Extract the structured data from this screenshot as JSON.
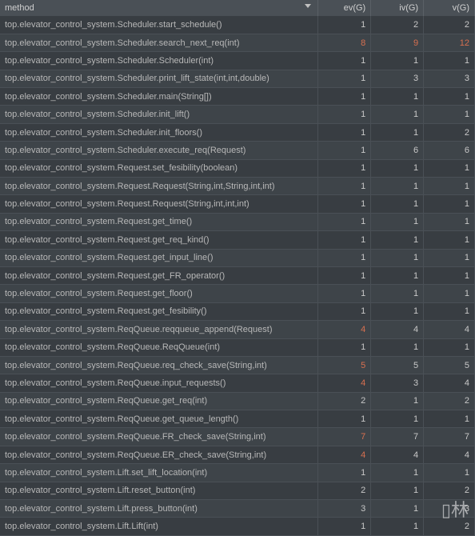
{
  "header": {
    "method": "method",
    "ev": "ev(G)",
    "iv": "iv(G)",
    "v": "v(G)"
  },
  "rows": [
    {
      "method": "top.elevator_control_system.Scheduler.start_schedule()",
      "ev": "1",
      "iv": "2",
      "v": "2",
      "h_ev": false,
      "h_iv": false,
      "h_v": false
    },
    {
      "method": "top.elevator_control_system.Scheduler.search_next_req(int)",
      "ev": "8",
      "iv": "9",
      "v": "12",
      "h_ev": true,
      "h_iv": true,
      "h_v": true
    },
    {
      "method": "top.elevator_control_system.Scheduler.Scheduler(int)",
      "ev": "1",
      "iv": "1",
      "v": "1",
      "h_ev": false,
      "h_iv": false,
      "h_v": false
    },
    {
      "method": "top.elevator_control_system.Scheduler.print_lift_state(int,int,double)",
      "ev": "1",
      "iv": "3",
      "v": "3",
      "h_ev": false,
      "h_iv": false,
      "h_v": false
    },
    {
      "method": "top.elevator_control_system.Scheduler.main(String[])",
      "ev": "1",
      "iv": "1",
      "v": "1",
      "h_ev": false,
      "h_iv": false,
      "h_v": false
    },
    {
      "method": "top.elevator_control_system.Scheduler.init_lift()",
      "ev": "1",
      "iv": "1",
      "v": "1",
      "h_ev": false,
      "h_iv": false,
      "h_v": false
    },
    {
      "method": "top.elevator_control_system.Scheduler.init_floors()",
      "ev": "1",
      "iv": "1",
      "v": "2",
      "h_ev": false,
      "h_iv": false,
      "h_v": false
    },
    {
      "method": "top.elevator_control_system.Scheduler.execute_req(Request)",
      "ev": "1",
      "iv": "6",
      "v": "6",
      "h_ev": false,
      "h_iv": false,
      "h_v": false
    },
    {
      "method": "top.elevator_control_system.Request.set_fesibility(boolean)",
      "ev": "1",
      "iv": "1",
      "v": "1",
      "h_ev": false,
      "h_iv": false,
      "h_v": false
    },
    {
      "method": "top.elevator_control_system.Request.Request(String,int,String,int,int)",
      "ev": "1",
      "iv": "1",
      "v": "1",
      "h_ev": false,
      "h_iv": false,
      "h_v": false
    },
    {
      "method": "top.elevator_control_system.Request.Request(String,int,int,int)",
      "ev": "1",
      "iv": "1",
      "v": "1",
      "h_ev": false,
      "h_iv": false,
      "h_v": false
    },
    {
      "method": "top.elevator_control_system.Request.get_time()",
      "ev": "1",
      "iv": "1",
      "v": "1",
      "h_ev": false,
      "h_iv": false,
      "h_v": false
    },
    {
      "method": "top.elevator_control_system.Request.get_req_kind()",
      "ev": "1",
      "iv": "1",
      "v": "1",
      "h_ev": false,
      "h_iv": false,
      "h_v": false
    },
    {
      "method": "top.elevator_control_system.Request.get_input_line()",
      "ev": "1",
      "iv": "1",
      "v": "1",
      "h_ev": false,
      "h_iv": false,
      "h_v": false
    },
    {
      "method": "top.elevator_control_system.Request.get_FR_operator()",
      "ev": "1",
      "iv": "1",
      "v": "1",
      "h_ev": false,
      "h_iv": false,
      "h_v": false
    },
    {
      "method": "top.elevator_control_system.Request.get_floor()",
      "ev": "1",
      "iv": "1",
      "v": "1",
      "h_ev": false,
      "h_iv": false,
      "h_v": false
    },
    {
      "method": "top.elevator_control_system.Request.get_fesibility()",
      "ev": "1",
      "iv": "1",
      "v": "1",
      "h_ev": false,
      "h_iv": false,
      "h_v": false
    },
    {
      "method": "top.elevator_control_system.ReqQueue.reqqueue_append(Request)",
      "ev": "4",
      "iv": "4",
      "v": "4",
      "h_ev": true,
      "h_iv": false,
      "h_v": false
    },
    {
      "method": "top.elevator_control_system.ReqQueue.ReqQueue(int)",
      "ev": "1",
      "iv": "1",
      "v": "1",
      "h_ev": false,
      "h_iv": false,
      "h_v": false
    },
    {
      "method": "top.elevator_control_system.ReqQueue.req_check_save(String,int)",
      "ev": "5",
      "iv": "5",
      "v": "5",
      "h_ev": true,
      "h_iv": false,
      "h_v": false
    },
    {
      "method": "top.elevator_control_system.ReqQueue.input_requests()",
      "ev": "4",
      "iv": "3",
      "v": "4",
      "h_ev": true,
      "h_iv": false,
      "h_v": false
    },
    {
      "method": "top.elevator_control_system.ReqQueue.get_req(int)",
      "ev": "2",
      "iv": "1",
      "v": "2",
      "h_ev": false,
      "h_iv": false,
      "h_v": false
    },
    {
      "method": "top.elevator_control_system.ReqQueue.get_queue_length()",
      "ev": "1",
      "iv": "1",
      "v": "1",
      "h_ev": false,
      "h_iv": false,
      "h_v": false
    },
    {
      "method": "top.elevator_control_system.ReqQueue.FR_check_save(String,int)",
      "ev": "7",
      "iv": "7",
      "v": "7",
      "h_ev": true,
      "h_iv": false,
      "h_v": false
    },
    {
      "method": "top.elevator_control_system.ReqQueue.ER_check_save(String,int)",
      "ev": "4",
      "iv": "4",
      "v": "4",
      "h_ev": true,
      "h_iv": false,
      "h_v": false
    },
    {
      "method": "top.elevator_control_system.Lift.set_lift_location(int)",
      "ev": "1",
      "iv": "1",
      "v": "1",
      "h_ev": false,
      "h_iv": false,
      "h_v": false
    },
    {
      "method": "top.elevator_control_system.Lift.reset_button(int)",
      "ev": "2",
      "iv": "1",
      "v": "2",
      "h_ev": false,
      "h_iv": false,
      "h_v": false
    },
    {
      "method": "top.elevator_control_system.Lift.press_button(int)",
      "ev": "3",
      "iv": "1",
      "v": "3",
      "h_ev": false,
      "h_iv": false,
      "h_v": false
    },
    {
      "method": "top.elevator_control_system.Lift.Lift(int)",
      "ev": "1",
      "iv": "1",
      "v": "2",
      "h_ev": false,
      "h_iv": false,
      "h_v": false
    }
  ],
  "watermark": "▯林"
}
